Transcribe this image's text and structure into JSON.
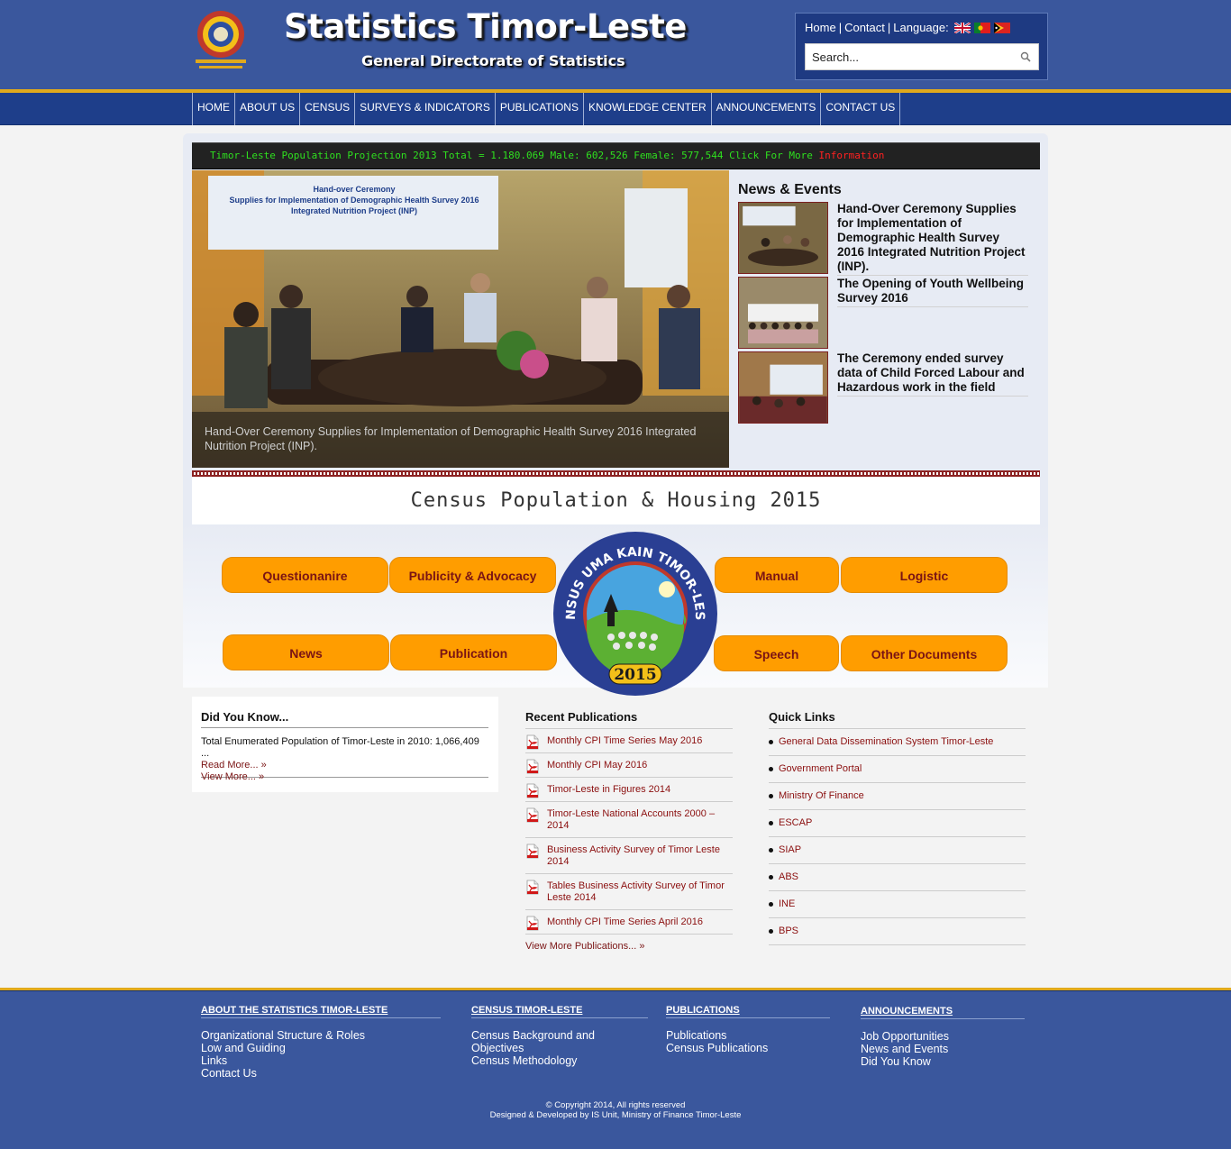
{
  "header": {
    "title": "Statistics Timor-Leste",
    "subtitle": "General Directorate of Statistics",
    "top_links": {
      "home": "Home",
      "contact": "Contact",
      "language": "Language:"
    },
    "search_placeholder": "Search...",
    "colors": {
      "header_bg": "#3a579d",
      "nav_bg": "#1e3e8a",
      "accent_stripe": "#e0a91c"
    }
  },
  "nav": {
    "items": [
      "HOME",
      "ABOUT US",
      "CENSUS",
      "SURVEYS & INDICATORS",
      "PUBLICATIONS",
      "KNOWLEDGE CENTER",
      "ANNOUNCEMENTS",
      "CONTACT US"
    ]
  },
  "ticker": {
    "text": "Timor-Leste Population Projection  2013 Total = 1.180.069 Male: 602,526 Female: 577,544  Click For More",
    "link": "Information"
  },
  "slider": {
    "caption": "Hand-Over Ceremony Supplies for Implementation of Demographic Health Survey 2016 Integrated Nutrition Project (INP)."
  },
  "news": {
    "title": "News & Events",
    "items": [
      {
        "title": "Hand-Over Ceremony Supplies for Implementation of Demographic Health Survey 2016 Integrated Nutrition Project (INP)."
      },
      {
        "title": "The Opening of Youth Wellbeing Survey 2016"
      },
      {
        "title": "The Ceremony ended survey data of Child Forced Labour and Hazardous work in the field"
      }
    ]
  },
  "census": {
    "title": "Census Population & Housing 2015",
    "buttons": {
      "questionnaire": "Questionanire",
      "publicity": "Publicity & Advocacy",
      "manual": "Manual",
      "logistic": "Logistic",
      "news": "News",
      "publication": "Publication",
      "speech": "Speech",
      "other": "Other Documents"
    },
    "logo": {
      "ring_text": "SENSUS UMA KAIN TIMOR-LESTE",
      "year": "2015"
    },
    "button_color": "#ff9d00"
  },
  "did_you_know": {
    "heading": "Did You Know...",
    "text": "Total Enumerated Population of Timor-Leste in 2010: 1,066,409 ...",
    "read_more": "Read More... »",
    "view_more": "View More... »"
  },
  "recent_publications": {
    "heading": "Recent Publications",
    "items": [
      "Monthly CPI Time Series May 2016",
      "Monthly CPI May 2016",
      "Timor-Leste in Figures 2014",
      "Timor-Leste National Accounts 2000 – 2014",
      "Business Activity Survey of Timor Leste 2014",
      "Tables Business Activity Survey of Timor Leste 2014",
      "Monthly CPI Time Series April 2016"
    ],
    "view_more": "View More Publications... »"
  },
  "quick_links": {
    "heading": "Quick Links",
    "items": [
      "General Data Dissemination System Timor-Leste",
      "Government Portal",
      "Ministry Of Finance",
      "ESCAP",
      "SIAP",
      "ABS",
      "INE",
      "BPS"
    ]
  },
  "footer": {
    "columns": [
      {
        "heading": "ABOUT THE STATISTICS TIMOR-LESTE",
        "links": [
          "Organizational Structure & Roles",
          "Low and Guiding",
          "Links",
          "Contact Us"
        ]
      },
      {
        "heading": "CENSUS TIMOR-LESTE",
        "links": [
          "Census Background and Objectives",
          "Census Methodology"
        ]
      },
      {
        "heading": "PUBLICATIONS",
        "links": [
          "Publications",
          "Census Publications"
        ]
      },
      {
        "heading": "ANNOUNCEMENTS",
        "links": [
          "Job Opportunities",
          "News and Events",
          "Did You Know"
        ]
      }
    ],
    "copyright": "© Copyright 2014, All rights reserved",
    "designed_by": "Designed & Developed by IS Unit, Ministry of Finance Timor-Leste"
  }
}
